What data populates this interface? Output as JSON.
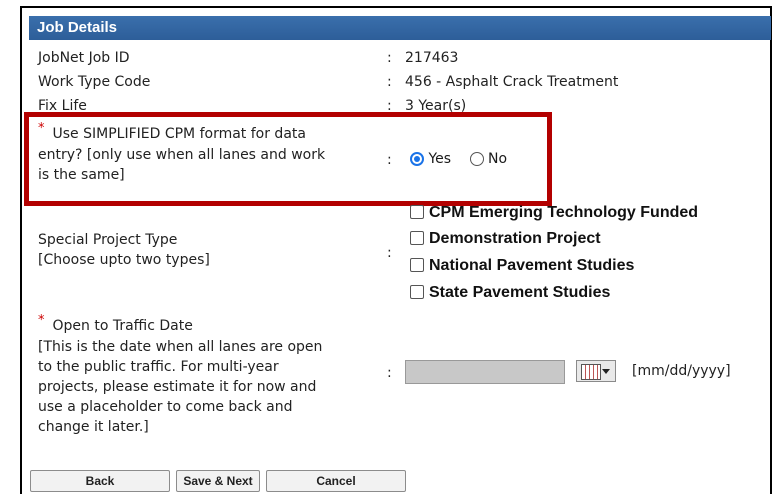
{
  "header": {
    "title": "Job Details"
  },
  "fields": {
    "job_id": {
      "label": "JobNet Job ID",
      "value": "217463"
    },
    "work_type": {
      "label": "Work Type Code",
      "value": "456 - Asphalt Crack Treatment"
    },
    "fix_life": {
      "label": "Fix Life",
      "value": "3 Year(s)"
    }
  },
  "colon": ":",
  "required_mark": "*",
  "simplified": {
    "label_line1": "Use SIMPLIFIED CPM format for data",
    "label_line2": "entry? [only use when all lanes and work",
    "label_line3": "is the same]",
    "options": [
      {
        "label": "Yes",
        "selected": true
      },
      {
        "label": "No",
        "selected": false
      }
    ]
  },
  "special_project": {
    "label_line1": "Special Project Type",
    "label_line2": "[Choose upto two types]",
    "options": [
      {
        "label": "CPM Emerging Technology Funded",
        "checked": false
      },
      {
        "label": "Demonstration Project",
        "checked": false
      },
      {
        "label": "National Pavement Studies",
        "checked": false
      },
      {
        "label": "State Pavement Studies",
        "checked": false
      }
    ]
  },
  "open_traffic": {
    "label_line1": "Open to Traffic Date",
    "label_line2": "[This is the date when all lanes are open",
    "label_line3": "to the public traffic. For multi-year",
    "label_line4": "projects, please estimate it for now and",
    "label_line5": "use a placeholder to come back and",
    "label_line6": "change it later.]",
    "value": "",
    "format_hint": "[mm/dd/yyyy]"
  },
  "buttons": {
    "back": "Back",
    "save_next": "Save & Next",
    "cancel": "Cancel"
  }
}
